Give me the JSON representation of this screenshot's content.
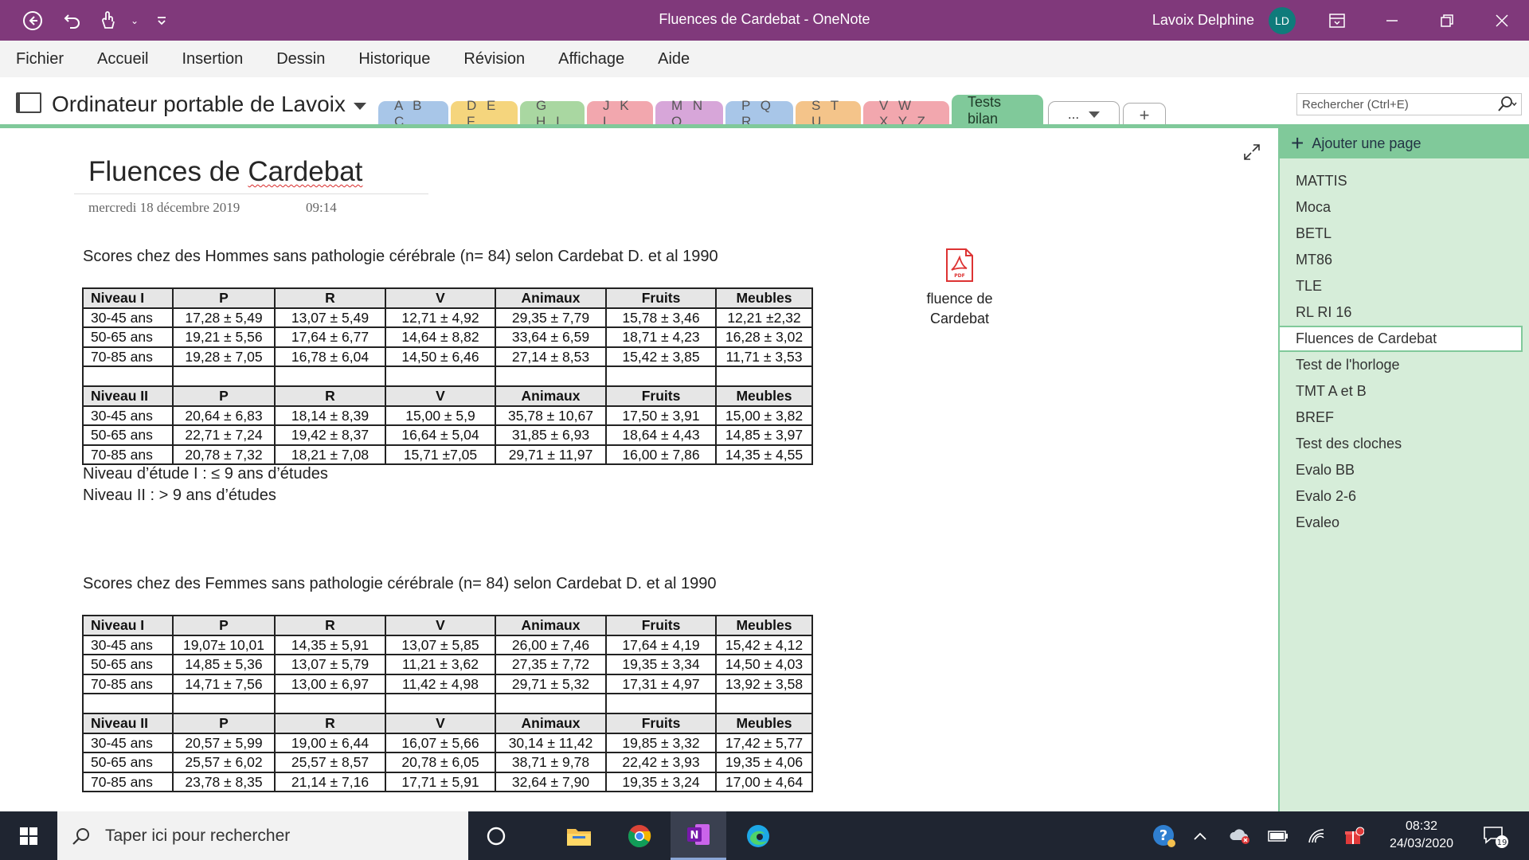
{
  "window": {
    "title": "Fluences de Cardebat  -  OneNote",
    "user_name": "Lavoix Delphine",
    "user_initials": "LD"
  },
  "menu": [
    "Fichier",
    "Accueil",
    "Insertion",
    "Dessin",
    "Historique",
    "Révision",
    "Affichage",
    "Aide"
  ],
  "notebook": {
    "name": "Ordinateur portable de Lavoix",
    "sections": [
      {
        "label": "A B C",
        "color": "#a8c6e8"
      },
      {
        "label": "D E F",
        "color": "#f5d57d"
      },
      {
        "label": "G H I",
        "color": "#a9d7a1"
      },
      {
        "label": "J K L",
        "color": "#f2a7ae"
      },
      {
        "label": "M N O",
        "color": "#d7a6d9"
      },
      {
        "label": "P Q R",
        "color": "#a8c6e8"
      },
      {
        "label": "S T U",
        "color": "#f4c48a"
      },
      {
        "label": "V W X Y Z",
        "color": "#f2a7ae"
      }
    ],
    "active_section": "Tests bilan",
    "more_label": "...",
    "add_label": "+"
  },
  "search": {
    "placeholder": "Rechercher (Ctrl+E)"
  },
  "page": {
    "title_part1": "Fluences de ",
    "title_part2": "Cardebat",
    "date": "mercredi 18 décembre 2019",
    "time": "09:14",
    "attachment": {
      "label_line1": "fluence de",
      "label_line2": "Cardebat",
      "icon": "pdf-icon"
    }
  },
  "tables": [
    {
      "caption": "Scores chez des Hommes sans pathologie cérébrale (n= 84) selon Cardebat D. et al 1990",
      "rows": [
        [
          "Niveau I",
          "P",
          "R",
          "V",
          "Animaux",
          "Fruits",
          "Meubles"
        ],
        [
          "30-45 ans",
          "17,28 ± 5,49",
          "13,07 ± 5,49",
          "12,71 ± 4,92",
          "29,35 ± 7,79",
          "15,78 ± 3,46",
          "12,21 ±2,32"
        ],
        [
          "50-65 ans",
          "19,21 ± 5,56",
          "17,64 ± 6,77",
          "14,64 ± 8,82",
          "33,64 ± 6,59",
          "18,71 ± 4,23",
          "16,28 ± 3,02"
        ],
        [
          "70-85 ans",
          "19,28 ± 7,05",
          "16,78 ± 6,04",
          "14,50 ± 6,46",
          "27,14 ± 8,53",
          "15,42 ± 3,85",
          "11,71 ± 3,53"
        ],
        [
          "",
          "",
          "",
          "",
          "",
          "",
          ""
        ],
        [
          "Niveau II",
          "P",
          "R",
          "V",
          "Animaux",
          "Fruits",
          "Meubles"
        ],
        [
          "30-45 ans",
          "20,64 ± 6,83",
          "18,14 ± 8,39",
          "15,00 ± 5,9",
          "35,78 ± 10,67",
          "17,50 ± 3,91",
          "15,00 ± 3,82"
        ],
        [
          "50-65 ans",
          "22,71 ± 7,24",
          "19,42 ± 8,37",
          "16,64 ± 5,04",
          "31,85 ± 6,93",
          "18,64 ± 4,43",
          "14,85 ± 3,97"
        ],
        [
          "70-85 ans",
          "20,78 ± 7,32",
          "18,21 ± 7,08",
          "15,71 ±7,05",
          "29,71 ± 11,97",
          "16,00 ± 7,86",
          "14,35 ± 4,55"
        ]
      ],
      "notes": [
        "Niveau d’étude I : ≤ 9 ans d’études",
        "Niveau II : > 9 ans d’études"
      ]
    },
    {
      "caption": "Scores chez des Femmes sans pathologie cérébrale (n= 84) selon Cardebat D. et al 1990",
      "rows": [
        [
          "Niveau I",
          "P",
          "R",
          "V",
          "Animaux",
          "Fruits",
          "Meubles"
        ],
        [
          "30-45 ans",
          "19,07± 10,01",
          "14,35 ± 5,91",
          "13,07 ± 5,85",
          "26,00 ± 7,46",
          "17,64 ± 4,19",
          "15,42 ± 4,12"
        ],
        [
          "50-65 ans",
          "14,85 ± 5,36",
          "13,07 ± 5,79",
          "11,21 ± 3,62",
          "27,35 ± 7,72",
          "19,35 ± 3,34",
          "14,50 ± 4,03"
        ],
        [
          "70-85 ans",
          "14,71 ± 7,56",
          "13,00 ± 6,97",
          "11,42 ± 4,98",
          "29,71 ± 5,32",
          "17,31 ± 4,97",
          "13,92 ± 3,58"
        ],
        [
          "",
          "",
          "",
          "",
          "",
          "",
          ""
        ],
        [
          "Niveau II",
          "P",
          "R",
          "V",
          "Animaux",
          "Fruits",
          "Meubles"
        ],
        [
          "30-45 ans",
          "20,57 ± 5,99",
          "19,00 ± 6,44",
          "16,07 ± 5,66",
          "30,14 ± 11,42",
          "19,85 ± 3,32",
          "17,42 ± 5,77"
        ],
        [
          "50-65 ans",
          "25,57 ± 6,02",
          "25,57 ± 8,57",
          "20,78 ± 6,05",
          "38,71 ± 9,78",
          "22,42 ± 3,93",
          "19,35 ± 4,06"
        ],
        [
          "70-85 ans",
          "23,78 ± 8,35",
          "21,14 ± 7,16",
          "17,71 ± 5,91",
          "32,64 ± 7,90",
          "19,35 ± 3,24",
          "17,00 ± 4,64"
        ]
      ],
      "notes": []
    }
  ],
  "pagelist": {
    "add_label": "Ajouter une page",
    "pages": [
      "MATTIS",
      "Moca",
      "BETL",
      "MT86",
      "TLE",
      "RL RI 16",
      "Fluences de Cardebat",
      "Test de l'horloge",
      "TMT A et B",
      "BREF",
      "Test des cloches",
      "Evalo BB",
      "Evalo 2-6",
      "Evaleo"
    ],
    "selected": "Fluences de Cardebat"
  },
  "taskbar": {
    "search_placeholder": "Taper ici pour rechercher",
    "time": "08:32",
    "date": "24/03/2020",
    "notification_count": "19"
  },
  "colors": {
    "onenote_purple": "#80397b",
    "section_green": "#80c99a",
    "pagelist_bg": "#d6edd9"
  }
}
